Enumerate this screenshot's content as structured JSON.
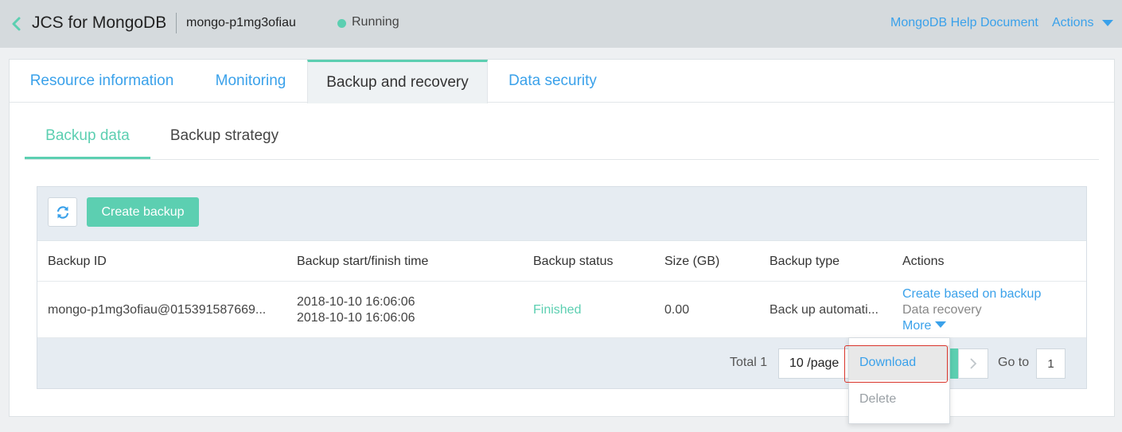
{
  "header": {
    "app_title": "JCS for MongoDB",
    "instance_name": "mongo-p1mg3ofiau",
    "status": "Running",
    "status_color": "#5ccfb1",
    "help_link": "MongoDB Help Document",
    "actions_label": "Actions"
  },
  "tabs": [
    {
      "label": "Resource information"
    },
    {
      "label": "Monitoring"
    },
    {
      "label": "Backup and recovery"
    },
    {
      "label": "Data security"
    }
  ],
  "subtabs": [
    {
      "label": "Backup data"
    },
    {
      "label": "Backup strategy"
    }
  ],
  "toolbar": {
    "create_label": "Create backup",
    "refresh_icon": "refresh-icon"
  },
  "table": {
    "columns": [
      "Backup ID",
      "Backup start/finish time",
      "Backup status",
      "Size (GB)",
      "Backup type",
      "Actions"
    ],
    "rows": [
      {
        "backup_id": "mongo-p1mg3ofiau@015391587669...",
        "start_time": "2018-10-10 16:06:06",
        "finish_time": "2018-10-10 16:06:06",
        "status": "Finished",
        "size": "0.00",
        "type": "Back up automati...",
        "action_create": "Create based on backup",
        "action_recovery": "Data recovery",
        "action_more": "More"
      }
    ]
  },
  "pagination": {
    "total": "Total 1",
    "page_size": "10 /page",
    "goto_label": "Go to",
    "goto_value": "1"
  },
  "more_menu": {
    "download": "Download",
    "delete": "Delete"
  },
  "colors": {
    "accent_green": "#5ccfb1",
    "link_blue": "#3aa1ea",
    "highlight_red": "#d9342b"
  }
}
